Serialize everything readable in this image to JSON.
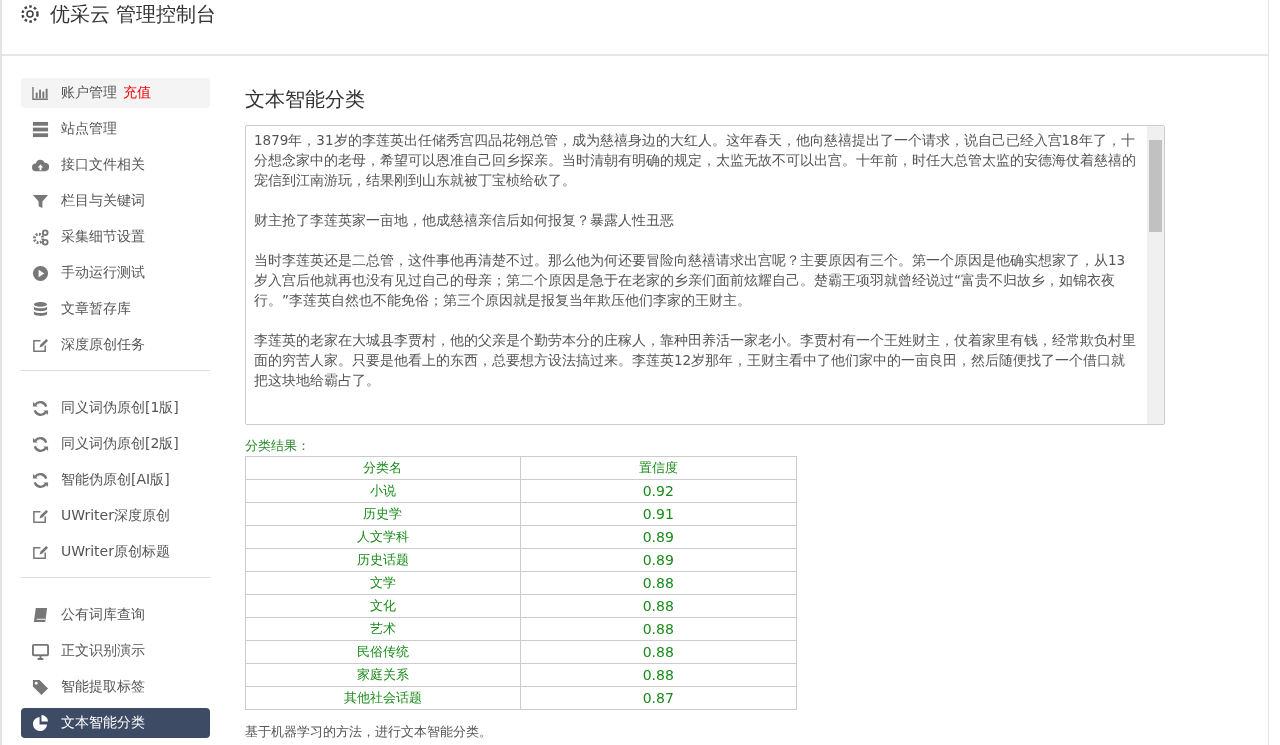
{
  "header": {
    "title": "优采云 管理控制台"
  },
  "sidebar": {
    "groups": [
      {
        "items": [
          {
            "label": "账户管理",
            "badge": "充值",
            "selected": false
          },
          {
            "label": "站点管理",
            "selected": false
          },
          {
            "label": "接口文件相关",
            "selected": false
          },
          {
            "label": "栏目与关键词",
            "selected": false
          },
          {
            "label": "采集细节设置",
            "selected": false
          },
          {
            "label": "手动运行测试",
            "selected": false
          },
          {
            "label": "文章暂存库",
            "selected": false
          },
          {
            "label": "深度原创任务",
            "selected": false
          }
        ]
      },
      {
        "items": [
          {
            "label": "同义词伪原创[1版]",
            "selected": false
          },
          {
            "label": "同义词伪原创[2版]",
            "selected": false
          },
          {
            "label": "智能伪原创[AI版]",
            "selected": false
          },
          {
            "label": "UWriter深度原创",
            "selected": false
          },
          {
            "label": "UWriter原创标题",
            "selected": false
          }
        ]
      },
      {
        "items": [
          {
            "label": "公有词库查询",
            "selected": false
          },
          {
            "label": "正文识别演示",
            "selected": false
          },
          {
            "label": "智能提取标签",
            "selected": false
          },
          {
            "label": "文本智能分类",
            "selected": true
          }
        ]
      }
    ]
  },
  "main": {
    "title": "文本智能分类",
    "text_input": {
      "paragraphs": [
        "1879年，31岁的李莲英出任储秀宫四品花翎总管，成为慈禧身边的大红人。这年春天，他向慈禧提出了一个请求，说自己已经入宫18年了，十分想念家中的老母，希望可以恩准自己回乡探亲。当时清朝有明确的规定，太监无故不可以出宫。十年前，时任大总管太监的安德海仗着慈禧的宠信到江南游玩，结果刚到山东就被丁宝桢给砍了。",
        "财主抢了李莲英家一亩地，他成慈禧亲信后如何报复？暴露人性丑恶",
        "当时李莲英还是二总管，这件事他再清楚不过。那么他为何还要冒险向慈禧请求出宫呢？主要原因有三个。第一个原因是他确实想家了，从13岁入宫后他就再也没有见过自己的母亲；第二个原因是急于在老家的乡亲们面前炫耀自己。楚霸王项羽就曾经说过“富贵不归故乡，如锦衣夜行。”李莲英自然也不能免俗；第三个原因就是报复当年欺压他们李家的王财主。",
        "李莲英的老家在大城县李贾村，他的父亲是个勤劳本分的庄稼人，靠种田养活一家老小。李贾村有一个王姓财主，仗着家里有钱，经常欺负村里面的穷苦人家。只要是他看上的东西，总要想方设法搞过来。李莲英12岁那年，王财主看中了他们家中的一亩良田，然后随便找了一个借口就把这块地给霸占了。"
      ]
    },
    "result_label": "分类结果：",
    "table": {
      "columns": [
        "分类名",
        "置信度"
      ],
      "rows": [
        [
          "小说",
          "0.92"
        ],
        [
          "历史学",
          "0.91"
        ],
        [
          "人文学科",
          "0.89"
        ],
        [
          "历史话题",
          "0.89"
        ],
        [
          "文学",
          "0.88"
        ],
        [
          "文化",
          "0.88"
        ],
        [
          "艺术",
          "0.88"
        ],
        [
          "民俗传统",
          "0.88"
        ],
        [
          "家庭关系",
          "0.88"
        ],
        [
          "其他社会话题",
          "0.87"
        ]
      ]
    },
    "footer_note": "基于机器学习的方法，进行文本智能分类。"
  }
}
